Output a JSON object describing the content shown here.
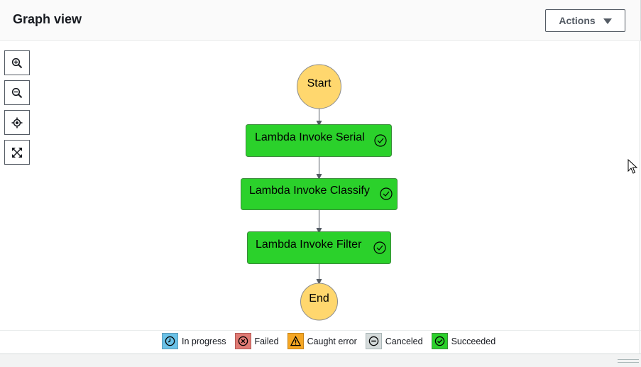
{
  "header": {
    "title": "Graph view",
    "actions_label": "Actions"
  },
  "zoom_controls": [
    {
      "name": "zoom-in-icon"
    },
    {
      "name": "zoom-out-icon"
    },
    {
      "name": "center-icon"
    },
    {
      "name": "fit-screen-icon"
    }
  ],
  "graph": {
    "start_label": "Start",
    "end_label": "End",
    "states": [
      {
        "label": "Lambda Invoke Serial",
        "status": "Succeeded"
      },
      {
        "label": "Lambda Invoke Classify",
        "status": "Succeeded"
      },
      {
        "label": "Lambda Invoke Filter",
        "status": "Succeeded"
      }
    ]
  },
  "legend": [
    {
      "label": "In progress",
      "color": "#6ac2e8",
      "icon": "clock-icon"
    },
    {
      "label": "Failed",
      "color": "#e07a74",
      "icon": "x-circle-icon"
    },
    {
      "label": "Caught error",
      "color": "#f5a623",
      "icon": "warning-icon"
    },
    {
      "label": "Canceled",
      "color": "#d5dbdb",
      "icon": "minus-circle-icon"
    },
    {
      "label": "Succeeded",
      "color": "#2bd12b",
      "icon": "check-circle-icon"
    }
  ],
  "colors": {
    "succeeded_fill": "#2bd12b",
    "start_end_fill": "#ffd76e"
  }
}
